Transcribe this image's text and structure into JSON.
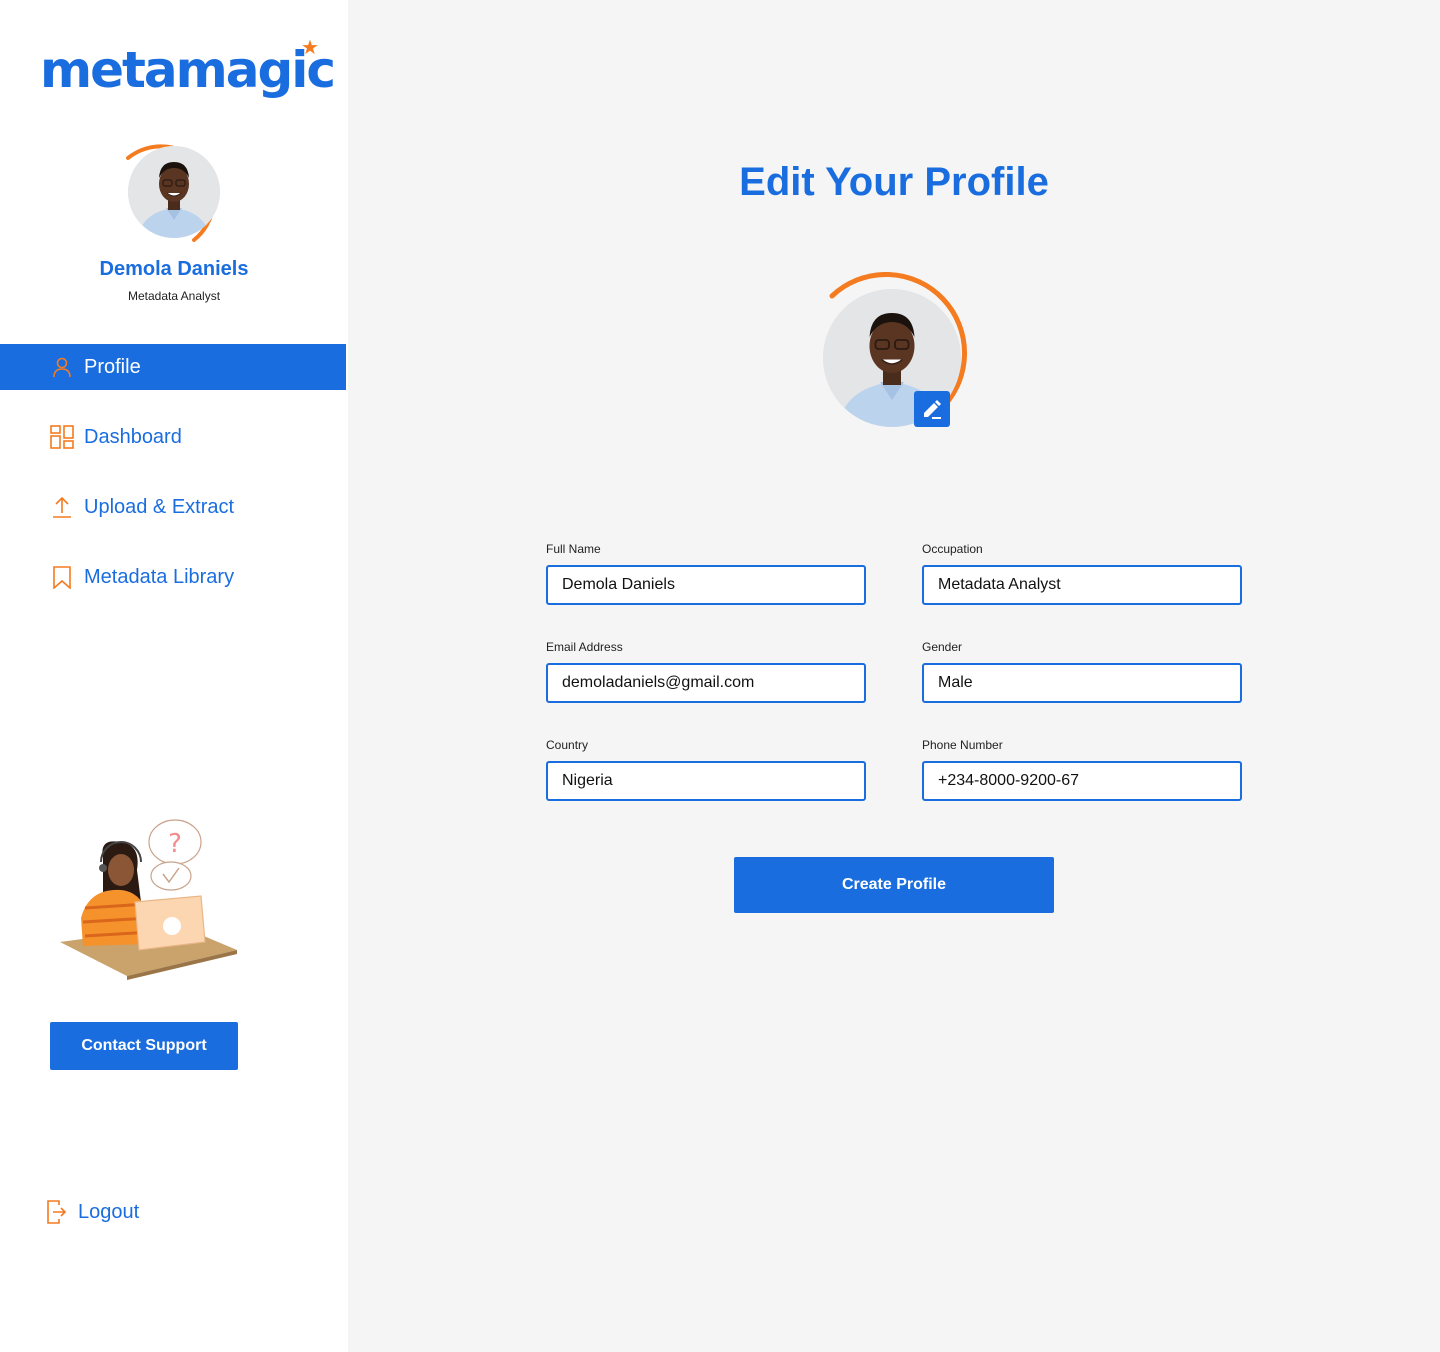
{
  "brand": {
    "logo_text": "metamagic",
    "primary_color": "#1a6ddf",
    "accent_color": "#f47b20"
  },
  "sidebar": {
    "user": {
      "name": "Demola Daniels",
      "role": "Metadata Analyst"
    },
    "nav": [
      {
        "label": "Profile",
        "icon": "user-icon",
        "active": true
      },
      {
        "label": "Dashboard",
        "icon": "grid-icon",
        "active": false
      },
      {
        "label": "Upload & Extract",
        "icon": "upload-icon",
        "active": false
      },
      {
        "label": "Metadata Library",
        "icon": "bookmark-icon",
        "active": false
      }
    ],
    "support_button": "Contact Support",
    "logout_label": "Logout"
  },
  "main": {
    "title": "Edit Your Profile",
    "form": {
      "full_name": {
        "label": "Full Name",
        "value": "Demola Daniels"
      },
      "occupation": {
        "label": "Occupation",
        "value": "Metadata Analyst"
      },
      "email": {
        "label": "Email Address",
        "value": "demoladaniels@gmail.com"
      },
      "gender": {
        "label": "Gender",
        "value": "Male"
      },
      "country": {
        "label": "Country",
        "value": "Nigeria"
      },
      "phone": {
        "label": "Phone Number",
        "value": "+234-8000-9200-67"
      }
    },
    "submit_label": "Create Profile"
  }
}
